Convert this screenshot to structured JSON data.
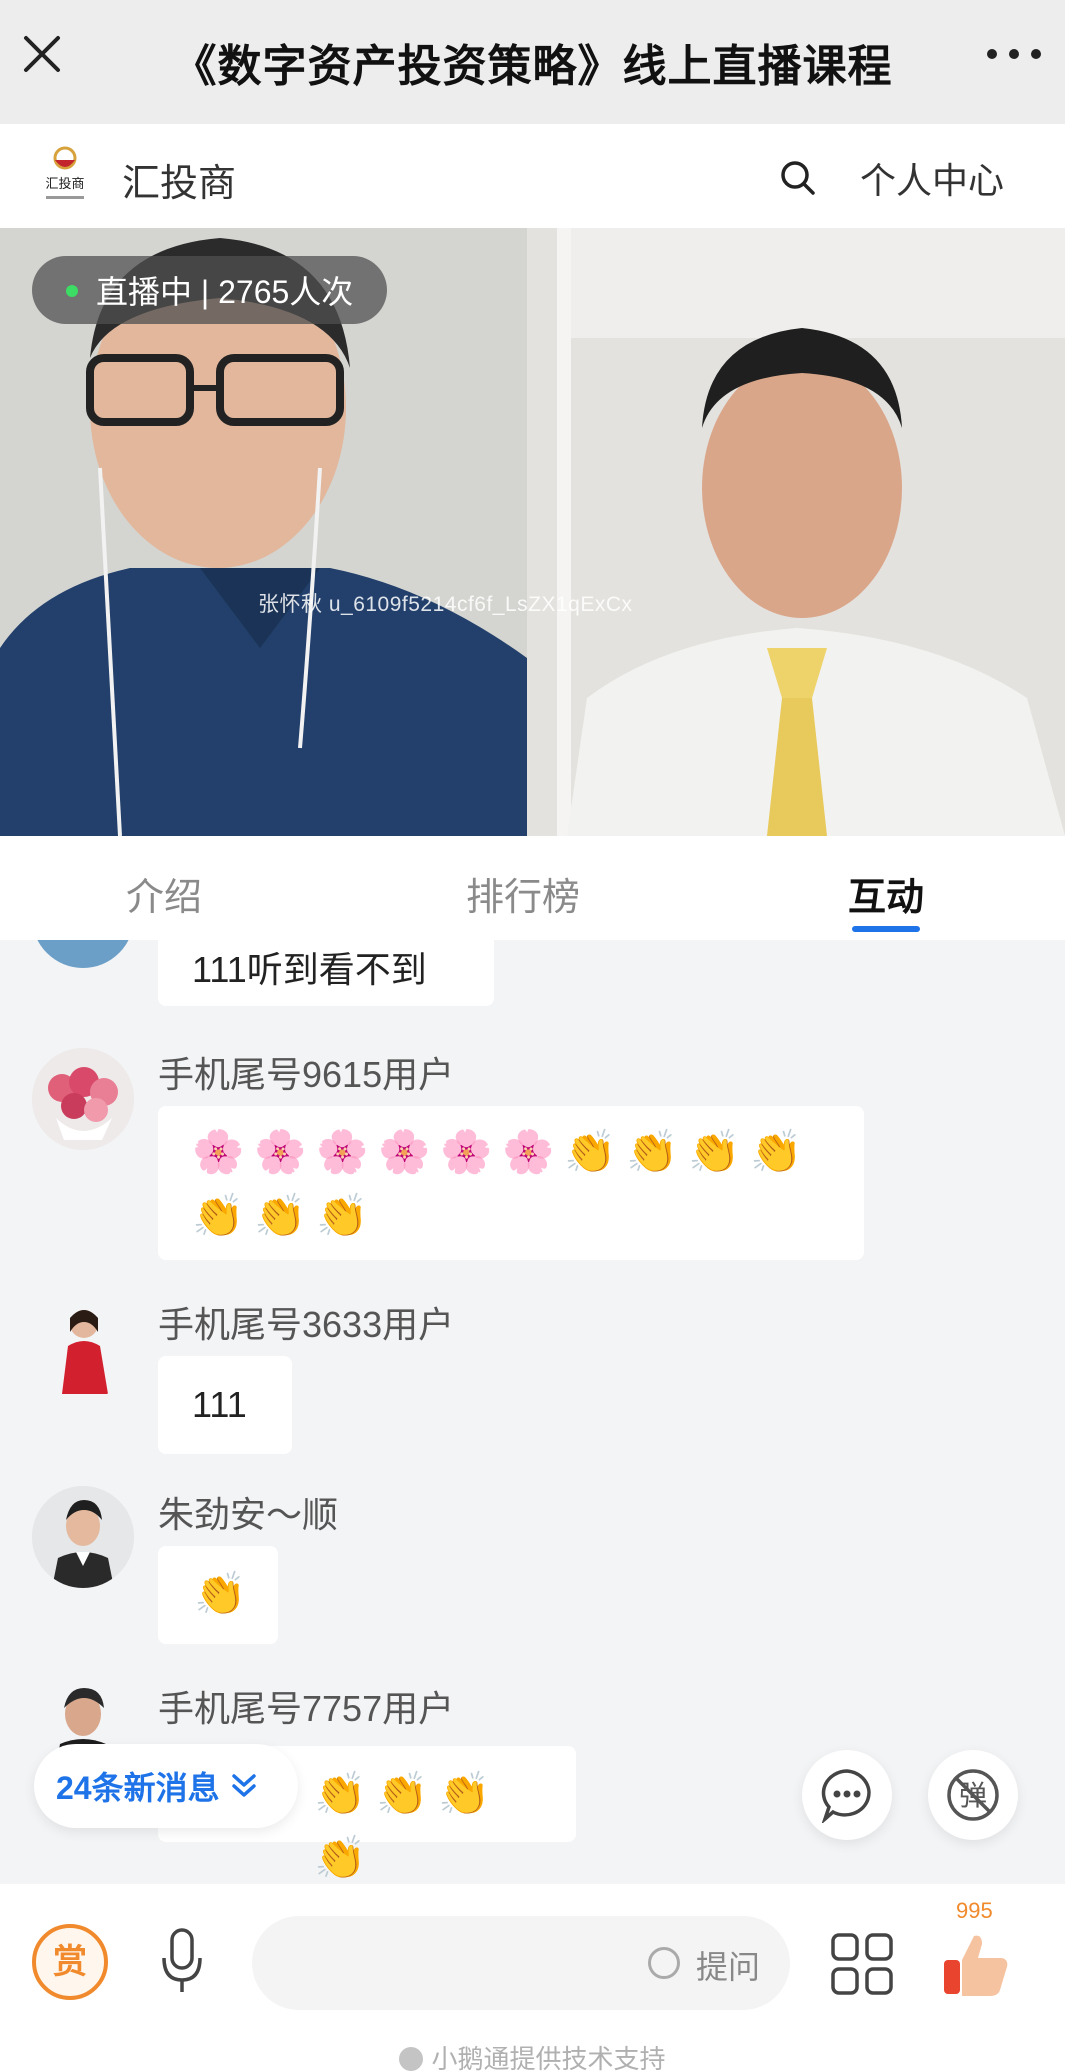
{
  "header": {
    "title": "《数字资产投资策略》线上直播课程",
    "close_icon": "close-icon",
    "more_icon": "more-icon"
  },
  "brand": {
    "name": "汇投商",
    "logo_text": "汇投商",
    "search_icon": "search-icon",
    "user_center": "个人中心"
  },
  "video": {
    "live_status": "直播中 | 2765人次",
    "watermark": "张怀秋 u_6109f5214cf6f_LsZX1qExCx"
  },
  "tabs": [
    {
      "label": "介绍",
      "active": false
    },
    {
      "label": "排行榜",
      "active": false
    },
    {
      "label": "互动",
      "active": true
    }
  ],
  "messages": [
    {
      "name": "",
      "text": "111听到看不到"
    },
    {
      "name": "手机尾号9615用户",
      "emojis": [
        "🌸",
        "🌸",
        "🌸",
        "🌸",
        "🌸",
        "🌸",
        "👏",
        "👏",
        "👏",
        "👏",
        "👏",
        "👏",
        "👏"
      ]
    },
    {
      "name": "手机尾号3633用户",
      "text": "111"
    },
    {
      "name": "朱劲安～顺",
      "emojis": [
        "👏"
      ]
    },
    {
      "name": "手机尾号7757用户",
      "emojis": [
        "👏",
        "👏",
        "👏",
        "👏"
      ]
    }
  ],
  "new_messages": "24条新消息",
  "bottom": {
    "reward_label": "赏",
    "ask_label": "提问",
    "like_count": "995",
    "support_text": "小鹅通提供技术支持"
  },
  "colors": {
    "accent": "#1e73e8",
    "reward": "#f08a2c",
    "live_dot": "#3ddc64"
  }
}
